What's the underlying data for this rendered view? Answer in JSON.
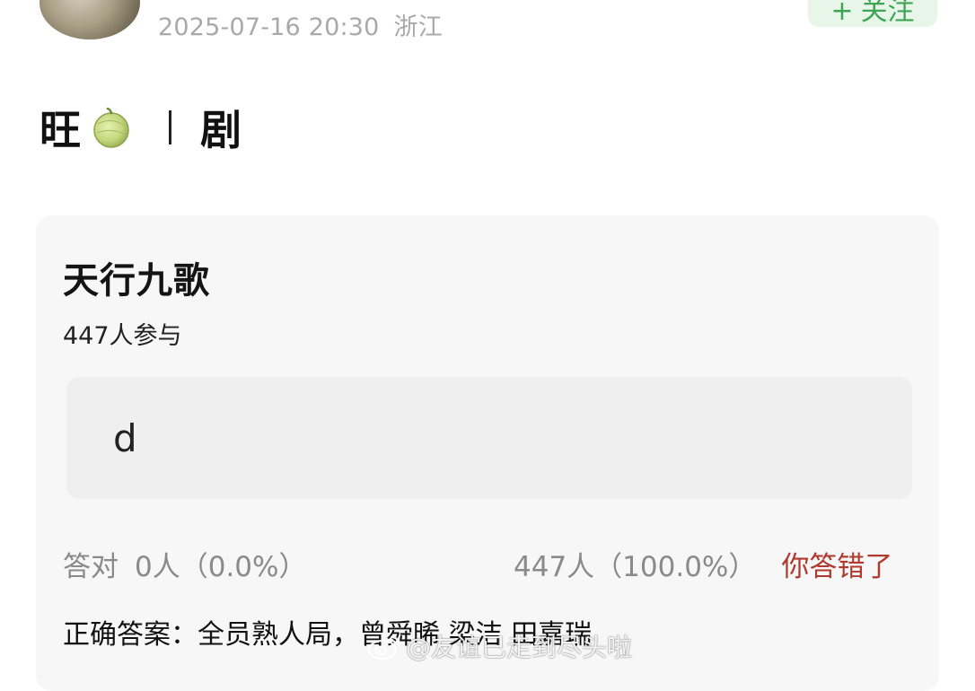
{
  "post": {
    "meta": {
      "datetime": "2025-07-16 20:30",
      "location": "浙江"
    },
    "follow_button": {
      "label": "关注",
      "icon": "plus-icon"
    },
    "title": {
      "left": "旺",
      "icon": "melon-icon",
      "right": "剧"
    }
  },
  "quiz": {
    "title": "天行九歌",
    "participants": "447人参与",
    "option": "d",
    "correct_label": "答对",
    "correct_count": "0人（0.0%）",
    "option_count": "447人（100.0%）",
    "result": "你答错了",
    "answer": "正确答案：全员熟人局，曾舜晞 梁洁 田嘉瑞"
  },
  "watermark": {
    "icon": "weibo-icon",
    "text": "@友谊已走到尽头啦"
  },
  "colors": {
    "accent_green": "#3fa454",
    "wrong_red": "#b03a2e",
    "card_bg": "#f7f7f7"
  }
}
